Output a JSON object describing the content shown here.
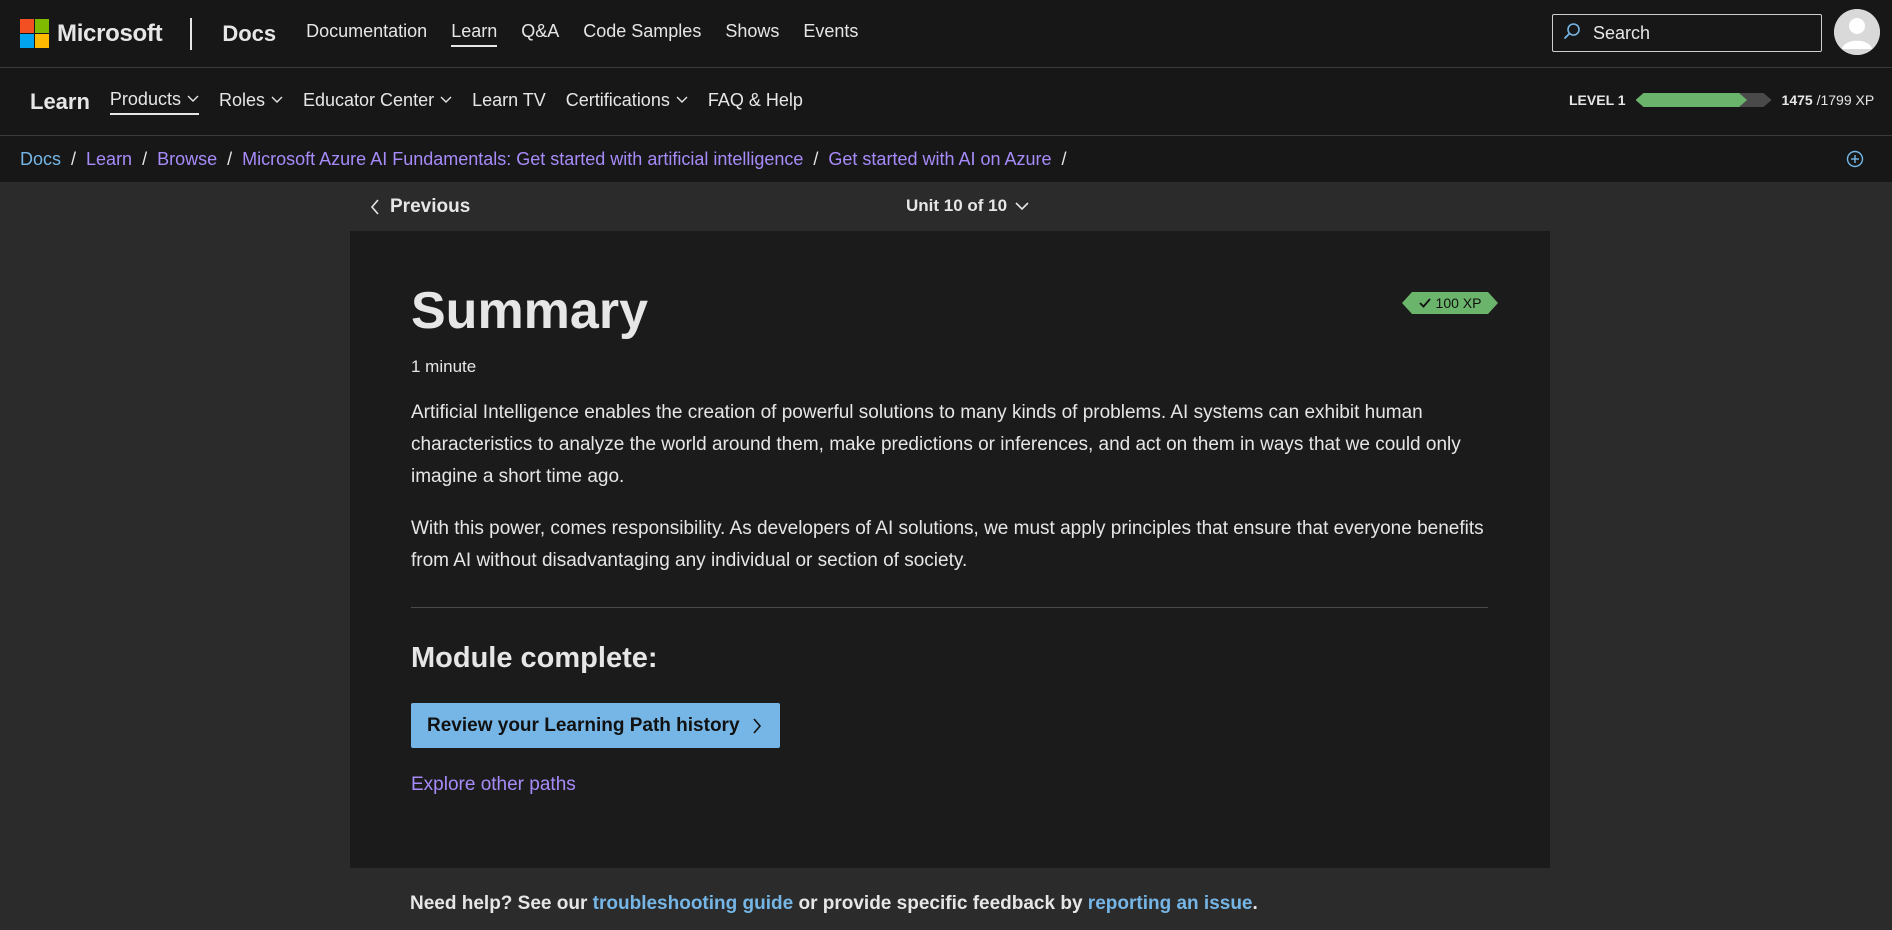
{
  "topbar": {
    "brand": "Microsoft",
    "brand_colors": [
      "#f25022",
      "#7fba00",
      "#00a4ef",
      "#ffb900"
    ],
    "section": "Docs",
    "nav": [
      {
        "label": "Documentation"
      },
      {
        "label": "Learn",
        "active": true
      },
      {
        "label": "Q&A"
      },
      {
        "label": "Code Samples"
      },
      {
        "label": "Shows"
      },
      {
        "label": "Events"
      }
    ],
    "search_placeholder": "Search",
    "search_icon": "search-icon",
    "avatar_icon": "user-avatar-icon"
  },
  "learnbar": {
    "title": "Learn",
    "nav": [
      {
        "label": "Products",
        "dropdown": true,
        "active": true
      },
      {
        "label": "Roles",
        "dropdown": true
      },
      {
        "label": "Educator Center",
        "dropdown": true
      },
      {
        "label": "Learn TV",
        "dropdown": false
      },
      {
        "label": "Certifications",
        "dropdown": true
      },
      {
        "label": "FAQ & Help",
        "dropdown": false
      }
    ],
    "level_label": "LEVEL 1",
    "xp_current": "1475",
    "xp_total": "/1799 XP",
    "progress_fraction": 0.82
  },
  "breadcrumb": {
    "items": [
      "Docs",
      "Learn",
      "Browse",
      "Microsoft Azure AI Fundamentals: Get started with artificial intelligence",
      "Get started with AI on Azure"
    ],
    "separator": "/"
  },
  "unit_nav": {
    "previous_label": "Previous",
    "unit_label": "Unit 10 of 10"
  },
  "content": {
    "title": "Summary",
    "duration": "1 minute",
    "xp_badge": "100 XP",
    "paragraphs": [
      "Artificial Intelligence enables the creation of powerful solutions to many kinds of problems. AI systems can exhibit human characteristics to analyze the world around them, make predictions or inferences, and act on them in ways that we could only imagine a short time ago.",
      "With this power, comes responsibility. As developers of AI solutions, we must apply principles that ensure that everyone benefits from AI without disadvantaging any individual or section of society."
    ],
    "module_complete": "Module complete:",
    "review_button": "Review your Learning Path history",
    "explore_link": "Explore other paths"
  },
  "help": {
    "prefix": "Need help? See our",
    "troubleshooting": "troubleshooting guide",
    "middle": "or provide specific feedback by",
    "report": "reporting an issue",
    "suffix": "."
  },
  "colors": {
    "link_blue": "#75b6e7",
    "link_purple": "#a78bfa",
    "progress_green": "#6bb46b"
  }
}
